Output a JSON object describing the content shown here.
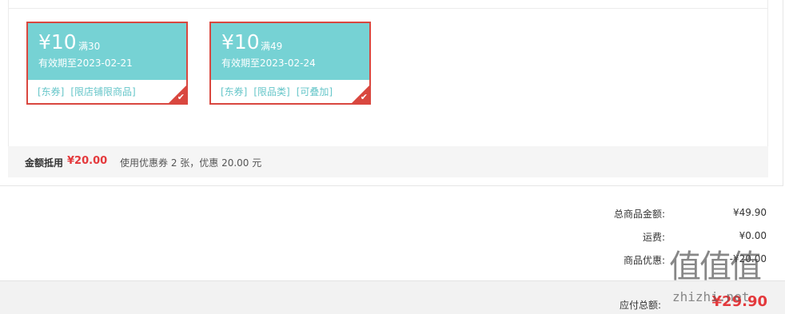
{
  "coupons": [
    {
      "amount": "¥10",
      "threshold": "满30",
      "validity": "有效期至2023-02-21",
      "tags": [
        "[东券]",
        "[限店铺限商品]"
      ],
      "selected": true
    },
    {
      "amount": "¥10",
      "threshold": "满49",
      "validity": "有效期至2023-02-24",
      "tags": [
        "[东券]",
        "[限品类]",
        "[可叠加]"
      ],
      "selected": true
    }
  ],
  "coupon_summary": {
    "label": "金额抵用",
    "amount": "¥20.00",
    "description": "使用优惠券 2 张，优惠 20.00 元"
  },
  "totals": {
    "goods_total_label": "总商品金额:",
    "goods_total_value": "¥49.90",
    "shipping_label": "运费:",
    "shipping_value": "¥0.00",
    "discount_label": "商品优惠:",
    "discount_value": "-¥20.00"
  },
  "payable": {
    "label": "应付总额:",
    "value": "¥29.90"
  },
  "watermark": {
    "logo": "值值值",
    "text": "zhizhi.net"
  },
  "colors": {
    "coupon_face": "#76d2d4",
    "coupon_border": "#d9473f",
    "price_red": "#e4393c"
  },
  "icons": {
    "selected_check": "check-icon"
  }
}
